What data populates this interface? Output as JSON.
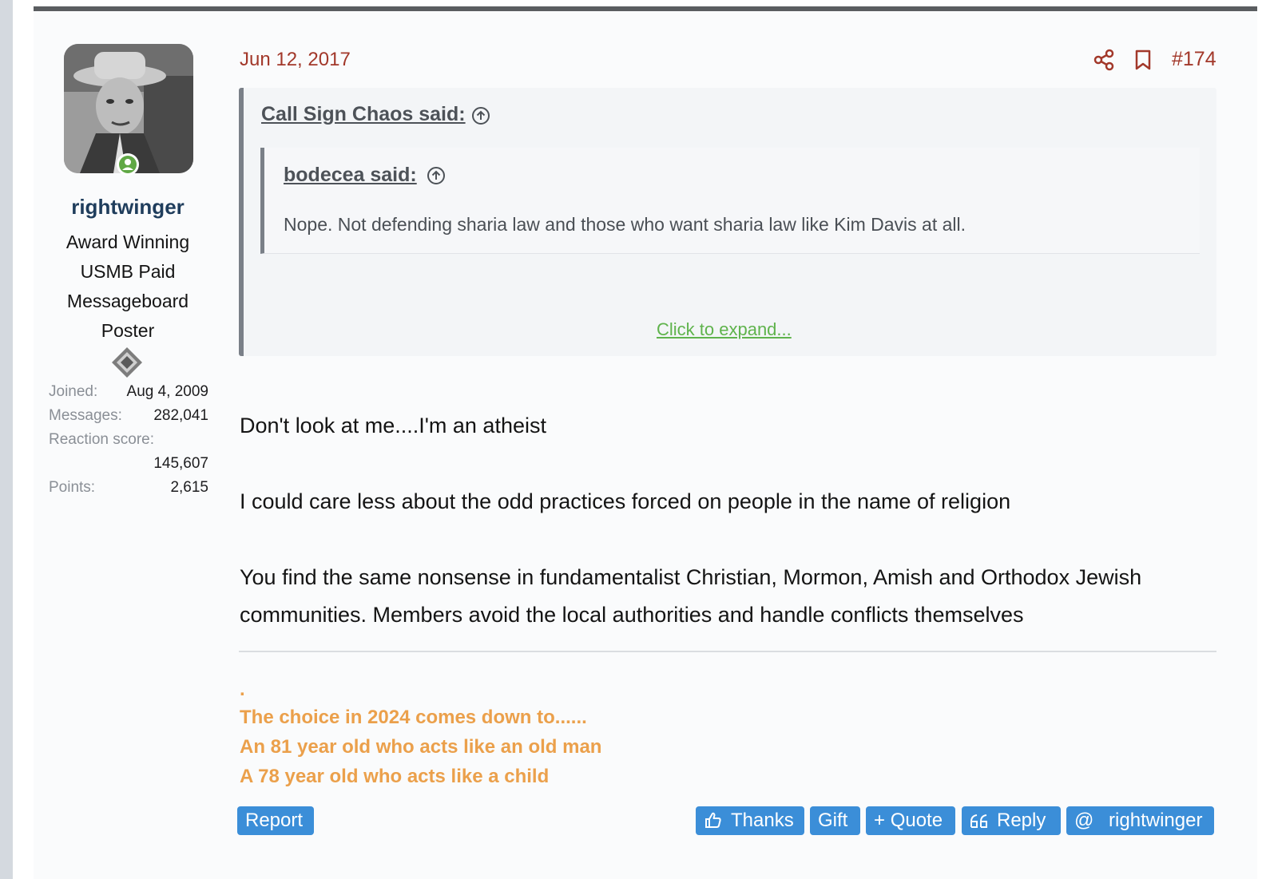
{
  "post": {
    "date": "Jun 12, 2017",
    "number": "#174",
    "header_icons": [
      "share-icon",
      "bookmark-icon"
    ]
  },
  "user": {
    "name": "rightwinger",
    "title": "Award Winning USMB Paid Messageboard Poster",
    "avatar_icon": "avatar-photo",
    "badge_icon": "og-badge-icon",
    "stats": {
      "joined_label": "Joined:",
      "joined_value": "Aug 4, 2009",
      "messages_label": "Messages:",
      "messages_value": "282,041",
      "reaction_label": "Reaction score:",
      "reaction_value": "145,607",
      "points_label": "Points:",
      "points_value": "2,615"
    }
  },
  "quote": {
    "outer_author": "Call Sign Chaos said:",
    "inner_author": "bodecea said:",
    "inner_text": "Nope. Not defending sharia law and those who want sharia law like Kim Davis at all.",
    "expand_label": "Click to expand..."
  },
  "body": {
    "p1": "Don't look at me....I'm an atheist",
    "p2": "I could care less about the odd practices forced on people in the name of religion",
    "p3_line1": "You find the same nonsense in fundamentalist Christian, Mormon, Amish and Orthodox Jewish",
    "p3_line2": "communities. Members avoid the local authorities and handle conflicts themselves"
  },
  "signature": {
    "dot": ".",
    "line1": "The choice in 2024 comes down to......",
    "line2": "An 81 year old who acts like an old man",
    "line3": "A 78 year old who acts like a child"
  },
  "actions": {
    "report": "Report",
    "thanks": "Thanks",
    "gift": "Gift",
    "quote": "Quote",
    "reply": "Reply",
    "mention": "rightwinger",
    "quote_prefix": "+",
    "mention_prefix": "@"
  },
  "colors": {
    "accent": "#3b8ed8",
    "date": "#a2382a",
    "signature": "#eba04b",
    "link": "#5fb34c",
    "username": "#1f3d5c"
  }
}
